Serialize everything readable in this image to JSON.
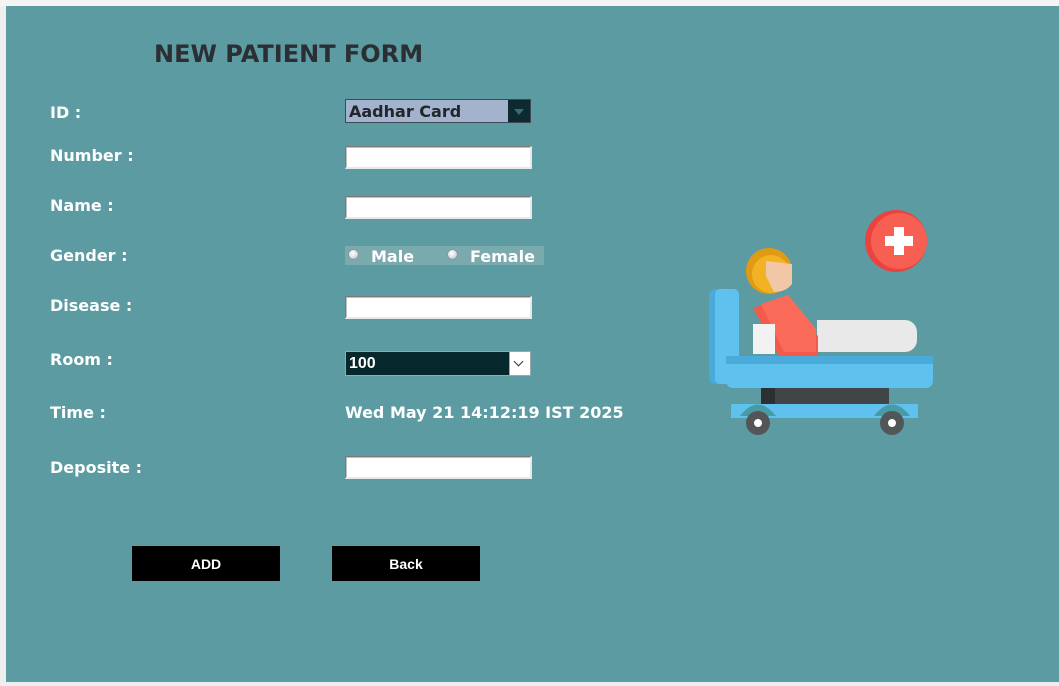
{
  "form": {
    "title": "NEW PATIENT FORM",
    "labels": {
      "id": "ID :",
      "number": "Number :",
      "name": "Name :",
      "gender": "Gender :",
      "disease": "Disease :",
      "room": "Room :",
      "time": "Time :",
      "deposite": "Deposite :"
    },
    "id_type_selected": "Aadhar Card",
    "number_value": "",
    "name_value": "",
    "gender_options": [
      "Male",
      "Female"
    ],
    "disease_value": "",
    "room_selected": "100",
    "time_value": "Wed May 21 14:12:19 IST 2025",
    "deposite_value": ""
  },
  "buttons": {
    "add_label": "ADD",
    "back_label": "Back"
  },
  "icons": {
    "patient_bed": "patient-bed-icon",
    "medical_cross": "medical-cross-icon"
  },
  "colors": {
    "background": "#5b9ba1",
    "title": "#2b2f33",
    "label": "#ffffff",
    "button": "#000000",
    "id_combo": "#a3b2cd",
    "room_combo": "#06282c"
  }
}
